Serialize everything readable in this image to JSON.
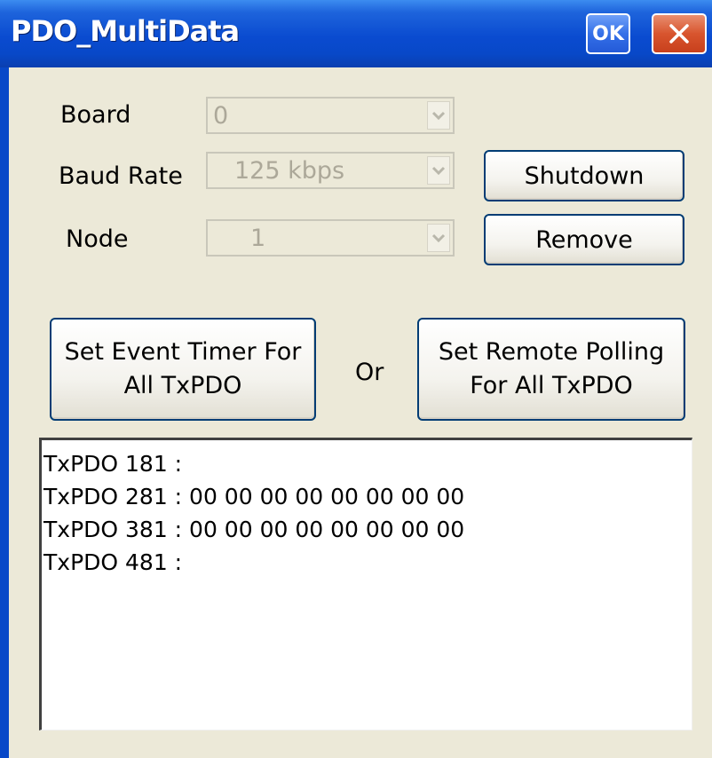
{
  "window": {
    "title": "PDO_MultiData",
    "ok_label": "OK"
  },
  "form": {
    "board": {
      "label": "Board",
      "value": "0"
    },
    "baud_rate": {
      "label": "Baud Rate",
      "value": "125 kbps"
    },
    "node": {
      "label": "Node",
      "value": "1"
    }
  },
  "buttons": {
    "shutdown": "Shutdown",
    "remove": "Remove",
    "event_timer_line1": "Set Event Timer For",
    "event_timer_line2": "All TxPDO",
    "or_label": "Or",
    "remote_polling_line1": "Set Remote Polling",
    "remote_polling_line2": "For All TxPDO"
  },
  "output": {
    "lines": [
      "TxPDO 181 :",
      "TxPDO 281 : 00 00 00 00 00 00 00 00",
      "TxPDO 381 : 00 00 00 00 00 00 00 00",
      "TxPDO 481 :"
    ]
  },
  "colors": {
    "titlebar": "#0A4BD0",
    "window_bg": "#ECE9D8",
    "button_border": "#003C74",
    "close_button": "#D8552E"
  },
  "icons": {
    "close": "close-icon",
    "dropdown": "chevron-down-icon"
  }
}
